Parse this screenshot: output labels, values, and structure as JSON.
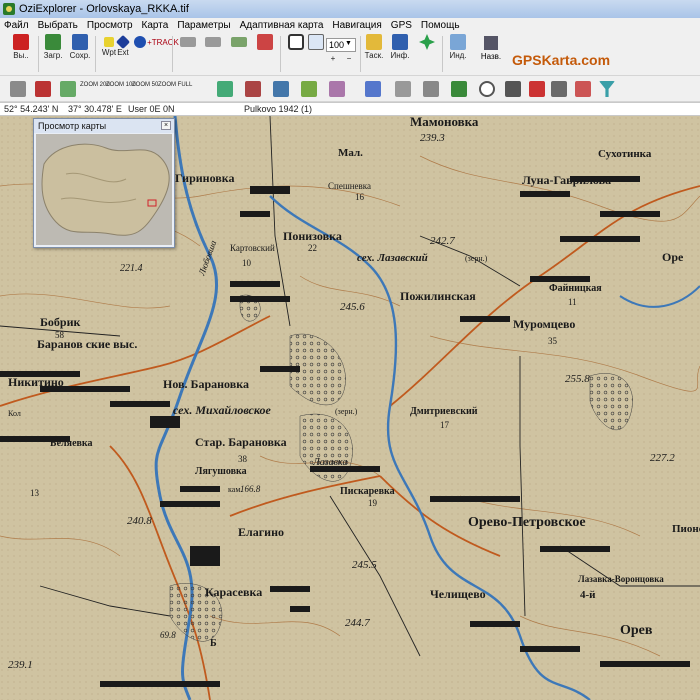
{
  "window": {
    "title": "OziExplorer - Orlovskaya_RKKA.tif"
  },
  "menu": [
    "Файл",
    "Выбрать",
    "Просмотр",
    "Карта",
    "Параметры",
    "Адаптивная карта",
    "Навигация",
    "GPS",
    "Помощь"
  ],
  "toolbar1": {
    "exit_label": "Вы..",
    "load_label": "Загр.",
    "save_label": "Сохр.",
    "wpt_label": "Wpt",
    "ext_label": "Ext",
    "track_label": "+TRACK",
    "zoom_value": "100",
    "task_label": "Таск.",
    "info_label": "Инф.",
    "ind_label": "Инд.",
    "name_label": "Назв.",
    "brand": "GPSKarta.com"
  },
  "toolbar2": {
    "zoom_labels": [
      "ZOOM 200",
      "ZOOM 100",
      "ZOOM 50",
      "ZOOM FULL"
    ]
  },
  "status": {
    "lat": "52° 54.243' N",
    "lon": "37° 30.478' E",
    "user": "User  0E  0N",
    "datum": "Pulkovo 1942 (1)"
  },
  "preview": {
    "title": "Просмотр карты",
    "close": "×"
  },
  "map": {
    "colors": {
      "paper": "#cfc3a1",
      "river": "#3d78b8",
      "road": "#c05a1e",
      "contour": "#a76a35"
    },
    "labels": [
      "Мамоновка",
      "239.3",
      "Мал.",
      "Сухотинка",
      "Гириновка",
      "Спешневка",
      "16",
      "Луна-Гаврилова",
      "Понизовка",
      "Картовский",
      "22",
      "10",
      "242.7",
      "сех. Лазавский",
      "(зерн.)",
      "Оре",
      "221.4",
      "Файницкая",
      "11",
      "245.6",
      "Пожилинская",
      "Бобрик",
      "58",
      "Баранов ские выс.",
      "Муромцево",
      "35",
      "Никитино",
      "Нов. Барановка",
      "сех. Михайловское",
      "(зерн.)",
      "255.8",
      "Дмитриевский",
      "17",
      "Беляевка",
      "Стар. Барановка",
      "227.2",
      "Лягушовка",
      "38",
      "Лазавка",
      "Пискаревка",
      "19",
      "240.8",
      "Елагино",
      "Орево-Петровское",
      "Пионе",
      "245.5",
      "Карасевка",
      "Челищево",
      "Лазавка-Воронцовка",
      "244.7",
      "4-й",
      "Орев",
      "239.1",
      "69.8",
      "Любовша",
      "кам.",
      "166.8",
      "13",
      "Б",
      "Кол"
    ]
  }
}
